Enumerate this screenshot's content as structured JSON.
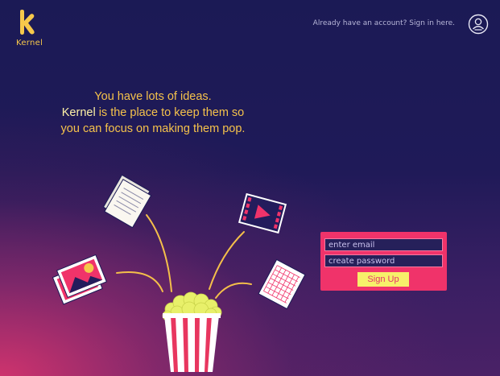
{
  "brand": {
    "name": "Kernel",
    "logo_color": "#f6c84b"
  },
  "header": {
    "signin_text": "Already have an account? Sign in here.",
    "user_icon": "user-avatar-icon"
  },
  "hero": {
    "line1": "You have lots of ideas.",
    "line2_brand": "Kernel",
    "line2_rest": " is the place to keep them so",
    "line3": "you can focus on making them pop."
  },
  "signup_form": {
    "email_placeholder": "enter email",
    "password_placeholder": "create password",
    "button_label": "Sign Up"
  },
  "illustration": {
    "items": [
      "document-icon",
      "video-icon",
      "photos-icon",
      "spreadsheet-icon",
      "popcorn-icon"
    ]
  },
  "colors": {
    "accent_pink": "#f0336a",
    "accent_yellow": "#f7f06a",
    "background_top": "#1b1a55",
    "text_gold": "#f5c24b"
  }
}
